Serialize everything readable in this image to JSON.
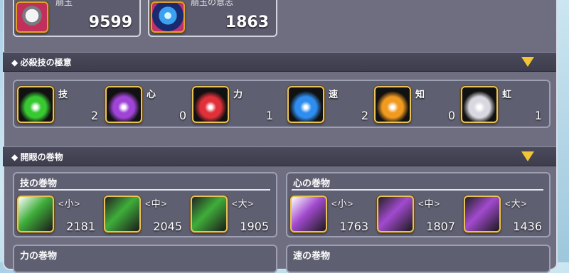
{
  "top_cards": [
    {
      "label": "崩玉",
      "value": "9599",
      "icon": "grey-gem-icon"
    },
    {
      "label": "崩玉の意志",
      "value": "1863",
      "icon": "blue-orb-icon"
    }
  ],
  "sections": {
    "hissatsu_title": "◆ 必殺技の極意",
    "kaigan_title": "◆ 開眼の巻物"
  },
  "orbs": [
    {
      "label": "技",
      "count": "2",
      "color": "#38c832"
    },
    {
      "label": "心",
      "count": "0",
      "color": "#a044d8"
    },
    {
      "label": "力",
      "count": "1",
      "color": "#e0303a"
    },
    {
      "label": "速",
      "count": "2",
      "color": "#2e8ef0"
    },
    {
      "label": "知",
      "count": "0",
      "color": "#f09a20"
    },
    {
      "label": "虹",
      "count": "1",
      "color": "#d8d8e0"
    }
  ],
  "scroll_groups": [
    {
      "title": "技の巻物",
      "color": "#3fae3a",
      "items": [
        {
          "size": "<小>",
          "count": "2181"
        },
        {
          "size": "<中>",
          "count": "2045"
        },
        {
          "size": "<大>",
          "count": "1905"
        }
      ]
    },
    {
      "title": "心の巻物",
      "color": "#a24ad0",
      "items": [
        {
          "size": "<小>",
          "count": "1763"
        },
        {
          "size": "<中>",
          "count": "1807"
        },
        {
          "size": "<大>",
          "count": "1436"
        }
      ]
    },
    {
      "title": "力の巻物",
      "color": "#d03a3a",
      "items": []
    },
    {
      "title": "速の巻物",
      "color": "#3a7ed0",
      "items": []
    }
  ]
}
